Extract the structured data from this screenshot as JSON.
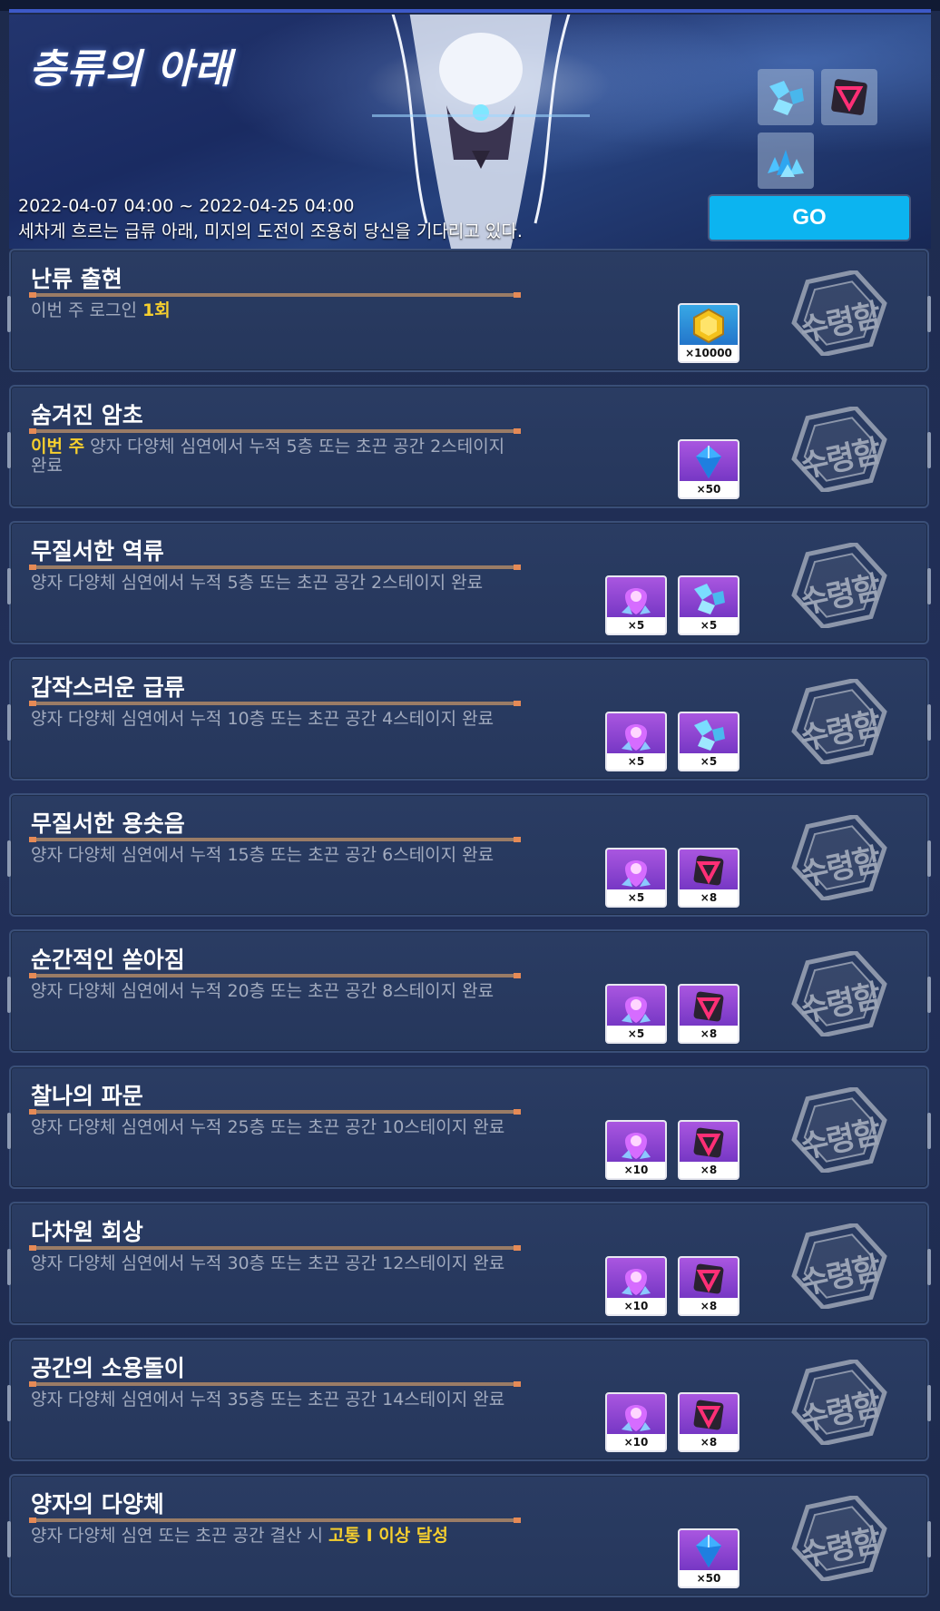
{
  "banner": {
    "title": "층류의 아래",
    "date": "2022-04-07 04:00 ~ 2022-04-25 04:00",
    "description": "세차게 흐르는 급류 아래, 미지의 도전이 조용히 당신을 기다리고 있다.",
    "go_label": "GO",
    "reward_icons": [
      "quantum-fragment-icon",
      "dark-core-icon",
      "crystal-pile-icon"
    ]
  },
  "stamp_label": "수령함",
  "missions": [
    {
      "title": "난류 출현",
      "desc_parts": [
        {
          "text": "이번 주 로그인 ",
          "hl": false
        },
        {
          "text": "1회",
          "hl": true
        }
      ],
      "rewards": [
        {
          "icon": "gold-coin-icon",
          "qty": "×10000",
          "bg": "blue"
        }
      ]
    },
    {
      "title": "숨겨진 암초",
      "desc_parts": [
        {
          "text": "이번 주",
          "hl": true
        },
        {
          "text": " 양자 다양체 심연에서 누적 5층 또는 초끈 공간 2스테이지 완료",
          "hl": false
        }
      ],
      "rewards": [
        {
          "icon": "crystal-icon",
          "qty": "×50",
          "bg": "purple"
        }
      ]
    },
    {
      "title": "무질서한 역류",
      "desc_parts": [
        {
          "text": "양자 다양체 심연에서 누적 5층 또는 초끈 공간 2스테이지 완료",
          "hl": false
        }
      ],
      "rewards": [
        {
          "icon": "purple-crystal-icon",
          "qty": "×5",
          "bg": "purple"
        },
        {
          "icon": "quantum-fragment-icon",
          "qty": "×5",
          "bg": "purple"
        }
      ]
    },
    {
      "title": "갑작스러운 급류",
      "desc_parts": [
        {
          "text": "양자 다양체 심연에서 누적 10층 또는 초끈 공간 4스테이지 완료",
          "hl": false
        }
      ],
      "rewards": [
        {
          "icon": "purple-crystal-icon",
          "qty": "×5",
          "bg": "purple"
        },
        {
          "icon": "quantum-fragment-icon",
          "qty": "×5",
          "bg": "purple"
        }
      ]
    },
    {
      "title": "무질서한 용솟음",
      "desc_parts": [
        {
          "text": "양자 다양체 심연에서 누적 15층 또는 초끈 공간 6스테이지 완료",
          "hl": false
        }
      ],
      "rewards": [
        {
          "icon": "purple-crystal-icon",
          "qty": "×5",
          "bg": "purple"
        },
        {
          "icon": "dark-core-icon",
          "qty": "×8",
          "bg": "purple"
        }
      ]
    },
    {
      "title": "순간적인 쏟아짐",
      "desc_parts": [
        {
          "text": "양자 다양체 심연에서 누적 20층 또는 초끈 공간 8스테이지 완료",
          "hl": false
        }
      ],
      "rewards": [
        {
          "icon": "purple-crystal-icon",
          "qty": "×5",
          "bg": "purple"
        },
        {
          "icon": "dark-core-icon",
          "qty": "×8",
          "bg": "purple"
        }
      ]
    },
    {
      "title": "찰나의 파문",
      "desc_parts": [
        {
          "text": "양자 다양체 심연에서 누적 25층 또는 초끈 공간 10스테이지 완료",
          "hl": false
        }
      ],
      "rewards": [
        {
          "icon": "purple-crystal-icon",
          "qty": "×10",
          "bg": "purple"
        },
        {
          "icon": "dark-core-icon",
          "qty": "×8",
          "bg": "purple"
        }
      ]
    },
    {
      "title": "다차원 회상",
      "desc_parts": [
        {
          "text": "양자 다양체 심연에서 누적 30층 또는 초끈 공간 12스테이지 완료",
          "hl": false
        }
      ],
      "rewards": [
        {
          "icon": "purple-crystal-icon",
          "qty": "×10",
          "bg": "purple"
        },
        {
          "icon": "dark-core-icon",
          "qty": "×8",
          "bg": "purple"
        }
      ]
    },
    {
      "title": "공간의 소용돌이",
      "desc_parts": [
        {
          "text": "양자 다양체 심연에서 누적 35층 또는 초끈 공간 14스테이지 완료",
          "hl": false
        }
      ],
      "rewards": [
        {
          "icon": "purple-crystal-icon",
          "qty": "×10",
          "bg": "purple"
        },
        {
          "icon": "dark-core-icon",
          "qty": "×8",
          "bg": "purple"
        }
      ]
    },
    {
      "title": "양자의 다양체",
      "desc_parts": [
        {
          "text": "양자 다양체 심연 또는 초끈 공간 결산 시 ",
          "hl": false
        },
        {
          "text": "고통 I 이상 달성",
          "hl": true
        }
      ],
      "rewards": [
        {
          "icon": "crystal-icon",
          "qty": "×50",
          "bg": "purple"
        }
      ]
    }
  ]
}
